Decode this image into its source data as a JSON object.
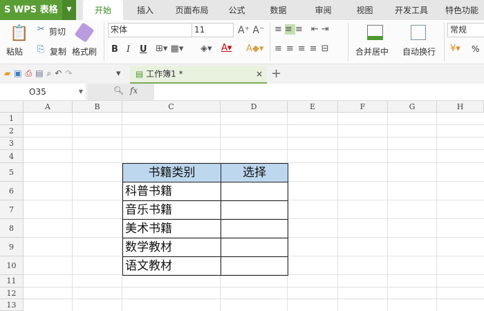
{
  "app": {
    "logo": "S WPS 表格"
  },
  "tabs": [
    "开始",
    "插入",
    "页面布局",
    "公式",
    "数据",
    "审阅",
    "视图",
    "开发工具",
    "特色功能"
  ],
  "ribbon": {
    "paste": "粘贴",
    "cut": "剪切",
    "copy": "复制",
    "format_painter": "格式刷",
    "font": "宋体",
    "font_size": "11",
    "bold": "B",
    "italic": "I",
    "underline": "U",
    "merge": "合并居中",
    "wrap": "自动换行",
    "number_format": "常规",
    "percent": "%"
  },
  "doc_tab": {
    "name": "工作簿1 *",
    "close": "×",
    "new": "+"
  },
  "formula_bar": {
    "name_box": "O35",
    "fx": "fx",
    "value": ""
  },
  "columns": [
    "A",
    "B",
    "C",
    "D",
    "E",
    "F",
    "G",
    "H"
  ],
  "rows": [
    "1",
    "2",
    "3",
    "4",
    "5",
    "6",
    "7",
    "8",
    "9",
    "10",
    "11",
    "12",
    "13"
  ],
  "table": {
    "headers": [
      "书籍类别",
      "选择"
    ],
    "items": [
      "科普书籍",
      "音乐书籍",
      "美术书籍",
      "数学教材",
      "语文教材"
    ]
  },
  "colors": {
    "header_fill": "#bdd7ee",
    "accent": "#5a9e35"
  }
}
